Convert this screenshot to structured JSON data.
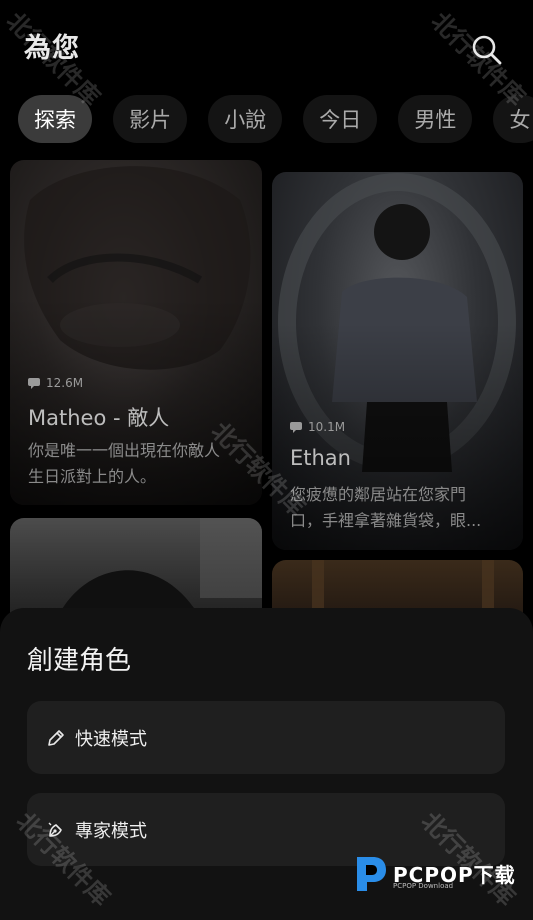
{
  "header": {
    "title": "為您",
    "search_icon": "search-icon"
  },
  "tabs": [
    "探索",
    "影片",
    "小說",
    "今日",
    "男性",
    "女"
  ],
  "cards": [
    {
      "stat": "12.6M",
      "name": "Matheo - 敵人",
      "desc_line1": "你是唯一一個出現在你敵人",
      "desc_line2": "生日派對上的人。"
    },
    {
      "stat": "10.1M",
      "name": "Ethan",
      "desc_line1": "您疲憊的鄰居站在您家門",
      "desc_line2": "口，手裡拿著雜貨袋，眼..."
    }
  ],
  "sheet": {
    "title": "創建角色",
    "options": [
      {
        "label": "快速模式",
        "icon": "pencil-icon"
      },
      {
        "label": "專家模式",
        "icon": "pen-nib-icon"
      }
    ]
  },
  "watermark": "北行软件库",
  "logo": {
    "text": "PCPOP下载",
    "sub": "PCPOP Download"
  },
  "colors": {
    "background": "#000000",
    "sheet": "#121212",
    "option": "#1f1f1f",
    "active_tab": "#3b3b3b"
  }
}
